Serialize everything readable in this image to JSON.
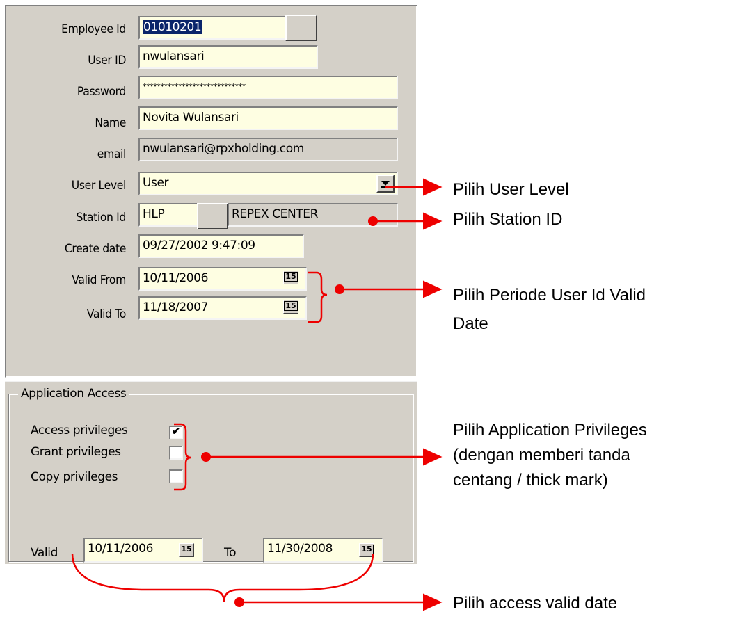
{
  "form": {
    "employee_id": {
      "label": "Employee Id",
      "value": "01010201"
    },
    "user_id": {
      "label": "User ID",
      "value": "nwulansari"
    },
    "password": {
      "label": "Password",
      "value": "*****************************"
    },
    "name": {
      "label": "Name",
      "value": "Novita  Wulansari"
    },
    "email": {
      "label": "email",
      "value": "nwulansari@rpxholding.com"
    },
    "user_level": {
      "label": "User Level",
      "value": "User"
    },
    "station_id": {
      "label": "Station Id",
      "value": "HLP",
      "station_name": "REPEX CENTER"
    },
    "create_date": {
      "label": "Create date",
      "value": "09/27/2002 9:47:09"
    },
    "valid_from": {
      "label": "Valid From",
      "value": "10/11/2006"
    },
    "valid_to": {
      "label": "Valid To",
      "value": "11/18/2007"
    },
    "calendar_icon_text": "15"
  },
  "application_access": {
    "title": "Application Access",
    "access_privileges": {
      "label": "Access privileges",
      "checked": true
    },
    "grant_privileges": {
      "label": "Grant privileges",
      "checked": false
    },
    "copy_privileges": {
      "label": "Copy privileges",
      "checked": false
    },
    "valid_label": "Valid",
    "valid_from": "10/11/2006",
    "to_label": "To",
    "valid_to": "11/30/2008"
  },
  "annotations": {
    "user_level": "Pilih User Level",
    "station_id": "Pilih Station ID",
    "period_line1": "Pilih Periode User Id Valid",
    "period_line2": "Date",
    "priv_line1": "Pilih Application Privileges",
    "priv_line2": "(dengan memberi tanda",
    "priv_line3": "centang / thick mark)",
    "access_valid": "Pilih access valid date"
  },
  "colors": {
    "annotation": "#ee0000",
    "field_bg": "#fefee2",
    "panel_bg": "#d4d0c8",
    "selection": "#0a246a"
  }
}
